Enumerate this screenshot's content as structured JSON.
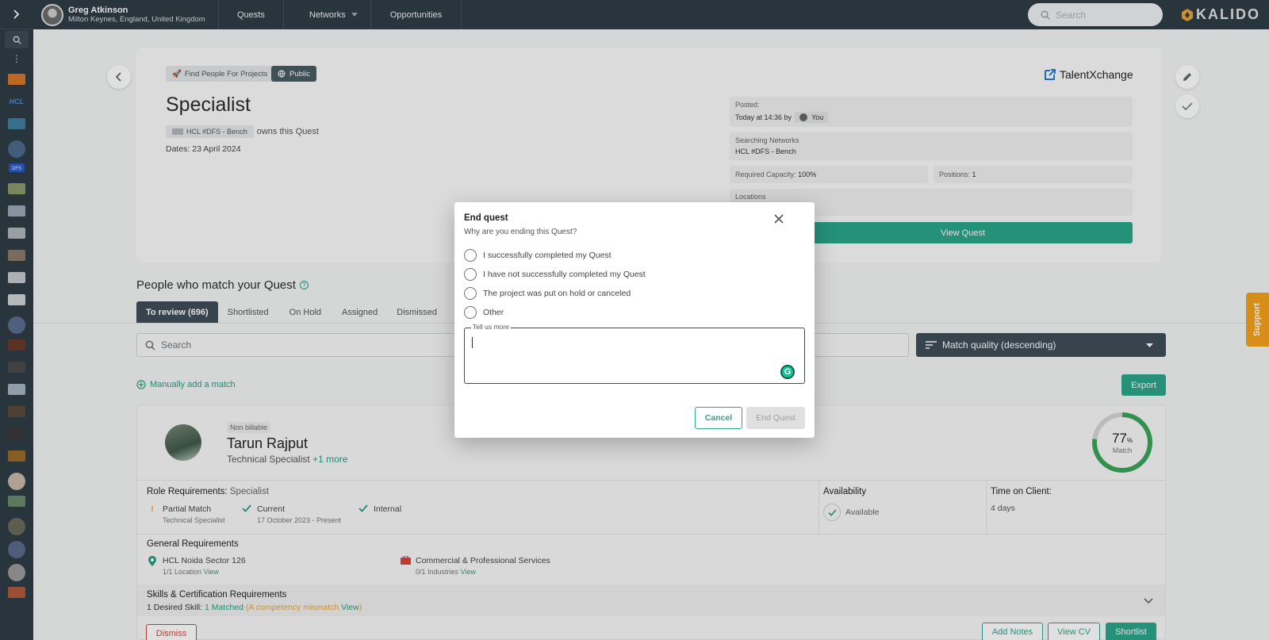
{
  "user": {
    "name": "Greg Atkinson",
    "location": "Milton Keynes, England, United Kingdom"
  },
  "nav": {
    "quests": "Quests",
    "networks": "Networks",
    "opportunities": "Opportunities"
  },
  "top_search": {
    "placeholder": "Search"
  },
  "logo": "KALIDO",
  "quest": {
    "tag_type": "Find People For Projects",
    "tag_visibility": "Public",
    "title": "Specialist",
    "owner_chip": "HCL #DFS - Bench",
    "owns_text": "owns this Quest",
    "dates": "Dates: 23 April 2024",
    "partner": "TalentXchange",
    "posted_label": "Posted:",
    "posted_value": "Today at 14:36 by",
    "posted_by": "You",
    "networks_label": "Searching Networks",
    "networks_value": "HCL #DFS - Bench",
    "capacity_label": "Required Capacity:",
    "capacity_value": "100%",
    "positions_label": "Positions:",
    "positions_value": "1",
    "locations_label": "Locations",
    "view_button": "View Quest"
  },
  "people": {
    "heading": "People who match your Quest",
    "tabs": [
      "To review (696)",
      "Shortlisted",
      "On Hold",
      "Assigned",
      "Dismissed"
    ],
    "search_placeholder": "Search",
    "sort_label": "Match quality (descending)",
    "add_match": "Manually add a match",
    "export": "Export"
  },
  "candidate": {
    "badge": "Non billable",
    "name": "Tarun Rajput",
    "role": "Technical Specialist",
    "role_more": "+1 more",
    "match_pct": "77",
    "match_unit": "%",
    "match_label": "Match",
    "role_req_label": "Role Requirements:",
    "role_req_value": "Specialist",
    "req1_title": "Partial Match",
    "req1_sub": "Technical Specialist",
    "req2_title": "Current",
    "req2_sub": "17 October 2023 - Present",
    "req3_title": "Internal",
    "availability_label": "Availability",
    "availability_value": "Available",
    "time_label": "Time on Client:",
    "time_value": "4 days",
    "general_label": "General Requirements",
    "loc_title": "HCL Noida Sector 126",
    "loc_sub": "1/1 Location",
    "ind_title": "Commercial & Professional Services",
    "ind_sub": "0/1 Industries",
    "view": "View",
    "skills_label": "Skills & Certification Requirements",
    "skills_line_a": "1 Desired Skill:",
    "skills_line_b": "1 Matched",
    "skills_line_c": "(A competency mismatch",
    "skills_line_d": "View",
    "skills_line_e": ")",
    "dismiss": "Dismiss",
    "add_notes": "Add Notes",
    "view_cv": "View CV",
    "shortlist": "Shortlist"
  },
  "support": "Support",
  "modal": {
    "title": "End quest",
    "subtitle": "Why are you ending this Quest?",
    "options": [
      "I successfully completed my Quest",
      "I have not successfully completed my Quest",
      "The project was put on hold or canceled",
      "Other"
    ],
    "textarea_label": "Tell us more",
    "cancel": "Cancel",
    "end": "End Quest"
  },
  "colors": {
    "accent": "#2ba68a",
    "nav_bg": "#2f3d46",
    "support": "#f5a21c"
  }
}
